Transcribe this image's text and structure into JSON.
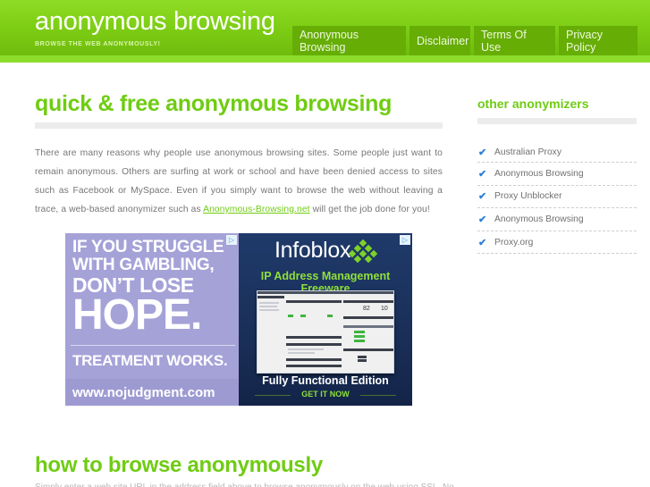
{
  "header": {
    "site_title": "anonymous browsing",
    "tagline": "BROWSE THE WEB ANONYMOUSLY!",
    "nav": [
      {
        "label": "Anonymous Browsing"
      },
      {
        "label": "Disclaimer"
      },
      {
        "label": "Terms Of Use"
      },
      {
        "label": "Privacy Policy"
      }
    ]
  },
  "main": {
    "heading": "quick & free anonymous browsing",
    "intro_before_link": "There are many reasons why people use anonymous browsing sites. Some people just want to remain anonymous. Others are surfing at work or school and have been denied access to sites such as Facebook or MySpace. Even if you simply want to browse the web without leaving a trace, a web-based anonymizer such as ",
    "intro_link": "Anonymous-Browsing.net",
    "intro_after_link": " will get the job done for you!",
    "section2_heading": "how to browse anonymously",
    "section2_text": "Simply enter a web site URL in the address field above to browse anonymously on the web using SSL. No"
  },
  "ads": {
    "left": {
      "lines": [
        "IF YOU STRUGGLE",
        "WITH GAMBLING,",
        "DON’T LOSE",
        "HOPE.",
        "TREATMENT WORKS.",
        "www.nojudgment.com"
      ],
      "badge_icon": "adchoices-icon"
    },
    "right": {
      "brand": "Infoblox",
      "subtitle": "IP Address Management Freeware",
      "screenshot_numbers": [
        "82",
        "10"
      ],
      "edition": "Fully Functional Edition",
      "cta": "GET IT NOW",
      "badge_icon": "adchoices-icon"
    }
  },
  "sidebar": {
    "title": "other anonymizers",
    "items": [
      {
        "label": "Australian Proxy",
        "icon": "checkmark-icon"
      },
      {
        "label": "Anonymous Browsing",
        "icon": "checkmark-icon"
      },
      {
        "label": "Proxy Unblocker",
        "icon": "checkmark-icon"
      },
      {
        "label": "Anonymous Browsing",
        "icon": "checkmark-icon"
      },
      {
        "label": "Proxy.org",
        "icon": "checkmark-icon"
      }
    ]
  },
  "colors": {
    "brand_green": "#6fcc12",
    "header_green": "#7fcf16",
    "nav_tab": "#66ad06",
    "check_blue": "#2f7fd4"
  }
}
